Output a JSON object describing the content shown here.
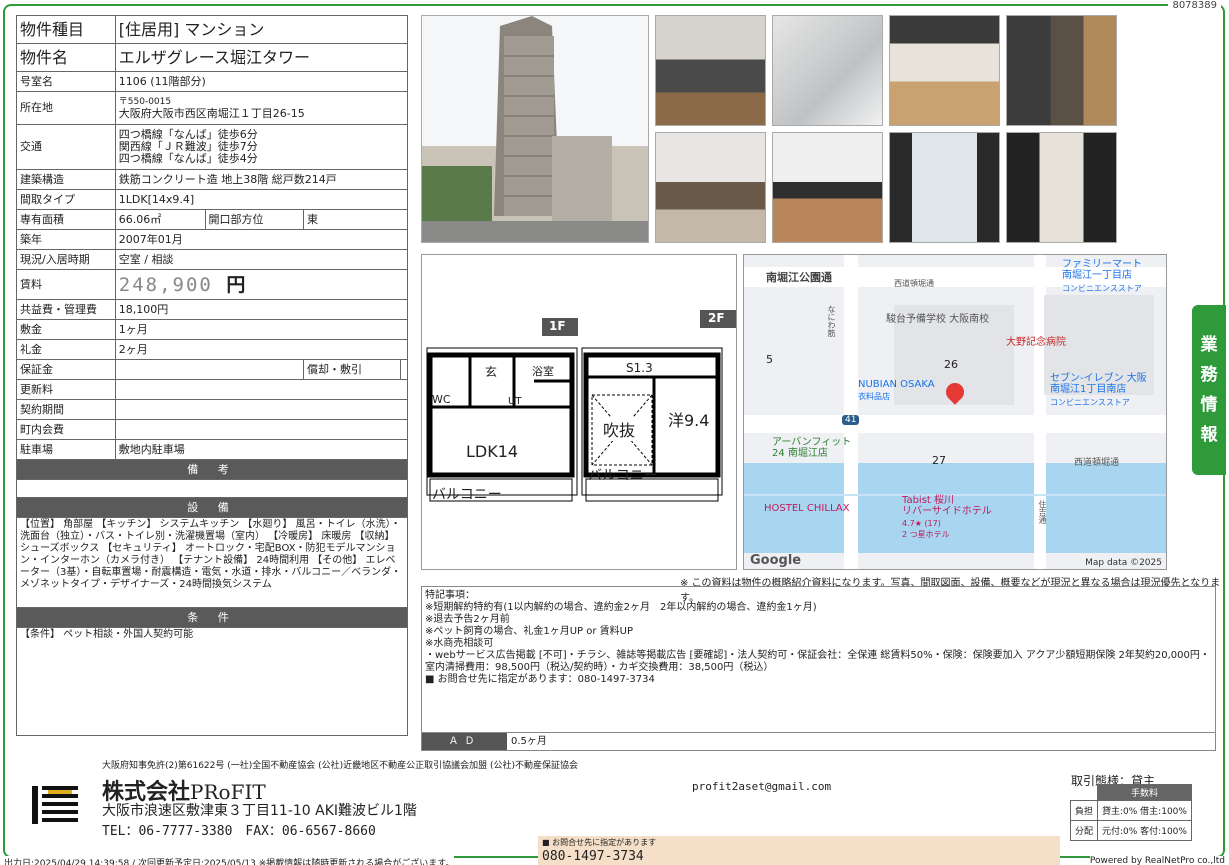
{
  "doc_no": "8078389",
  "spec": {
    "type_label": "物件種目",
    "type_value": "[住居用] マンション",
    "name_label": "物件名",
    "name_value": "エルザグレース堀江タワー",
    "room_label": "号室名",
    "room_value": "1106 (11階部分)",
    "addr_label": "所在地",
    "zip": "〒550-0015",
    "addr": "大阪府大阪市西区南堀江１丁目26-15",
    "traffic_label": "交通",
    "traffic": [
      "四つ橋線「なんば」徒歩6分",
      "関西線「ＪＲ難波」徒歩7分",
      "四つ橋線「なんば」徒歩4分"
    ],
    "structure_label": "建築構造",
    "structure": "鉄筋コンクリート造 地上38階 総戸数214戸",
    "layout_label": "間取タイプ",
    "layout": "1LDK[14x9.4]",
    "area_label": "専有面積",
    "area": "66.06㎡",
    "dir_label": "開口部方位",
    "dir": "東",
    "built_label": "築年",
    "built": "2007年01月",
    "status_label": "現況/入居時期",
    "status": "空室 / 相談",
    "rent_label": "賃料",
    "rent": "248,900",
    "yen": "円",
    "fee_label": "共益費・管理費",
    "fee": "18,100円",
    "deposit_label": "敷金",
    "deposit": "1ヶ月",
    "key_label": "礼金",
    "key": "2ヶ月",
    "hosho_label": "保証金",
    "shokyaku": "償却・敷引",
    "renew_label": "更新料",
    "period_label": "契約期間",
    "town_label": "町内会費",
    "parking_label": "駐車場",
    "parking": "敷地内駐車場",
    "remarks_title": "備 考",
    "equip_title": "設 備",
    "equip": "【位置】 角部屋 【キッチン】 システムキッチン 【水廻り】 風呂・トイレ（水洗）・洗面台（独立）・バス・トイレ別・洗濯機置場（室内） 【冷暖房】 床暖房 【収納】 シューズボックス 【セキュリティ】 オートロック・宅配BOX・防犯モデルマンション・インターホン（カメラ付き） 【テナント設備】 24時間利用 【その他】 エレベーター（3基）・自転車置場・耐震構造・電気・水道・排水・バルコニー／ベランダ・メゾネットタイプ・デザイナーズ・24時間換気システム",
    "cond_title": "条 件",
    "cond": "【条件】 ペット相談・外国人契約可能"
  },
  "floorplan": {
    "f1": "1F",
    "f2": "2F",
    "genkan": "玄",
    "yokushitsu": "浴室",
    "wc": "WC",
    "ut": "UT",
    "ldk": "LDK14",
    "balcony1": "バルコニー",
    "s13": "S1.3",
    "fukinuke": "吹抜",
    "yo": "洋9.4",
    "balcony2": "バルコニー"
  },
  "map": {
    "road1": "南堀江公園通",
    "road2": "西道頓堀通",
    "road3": "西道頓堀通",
    "school": "駿台予備学校 大阪南校",
    "hospital": "大野記念病院",
    "fm": "ファミリーマート\n南堀江一丁目店",
    "fm_sub": "コンビニエンスストア",
    "se": "セブン-イレブン 大阪\n南堀江1丁目南店",
    "se_sub": "コンビニエンスストア",
    "nubian": "NUBIAN OSAKA",
    "nubian_sub": "衣料品店",
    "gym": "アーバンフィット\n24 南堀江店",
    "hostel": "HOSTEL CHILLAX",
    "tabist": "Tabist 桜川\nリバーサイドホテル",
    "rating": "4.7★ (17)",
    "hotel2": "2 つ星ホテル",
    "block5": "5",
    "block26": "26",
    "block27": "27",
    "route41": "41",
    "google": "Google",
    "mapdata": "Map data ©2025",
    "vert1": "なにわ筋",
    "vert2": "住吉通"
  },
  "map_note": "※ この資料は物件の概略紹介資料になります。写真、間取図面、設備、概要などが現況と異なる場合は現況優先となります。",
  "notes": "特記事項：\n※短期解約特約有(1以内解約の場合、違約金2ヶ月　2年以内解約の場合、違約金1ヶ月)\n※退去予告2ヶ月前\n※ペット飼育の場合、礼金1ヶ月UP or 賃料UP\n※水商売相談可\n・webサービス広告掲載 [不可]・チラシ、雑誌等掲載広告 [要確認]・法人契約可・保証会社：全保連 総賃料50%・保険：保険要加入 アクア少額短期保険 2年契約20,000円・室内清掃費用：98,500円（税込/契約時）・カギ交換費用：38,500円（税込）\n■ お問合せ先に指定があります：080-1497-3734",
  "ad_label": "ＡＤ",
  "ad_value": "0.5ヶ月",
  "tab": [
    "業",
    "務",
    "情",
    "報"
  ],
  "footer": {
    "license": "大阪府知事免許(2)第61622号 (一社)全国不動産協会 (公社)近畿地区不動産公正取引協議会加盟 (公社)不動産保証協会",
    "company": "株式会社",
    "company_en": "PRoFIT",
    "address": "大阪市浪速区敷津東３丁目11-10 AKI難波ビル1階",
    "tel": "TEL：06-7777-3380　FAX：06-6567-8660",
    "email": "profit2aset@gmail.com",
    "contact_note": "■ お問合せ先に指定があります",
    "contact_tel": "080-1497-3734",
    "deal_label": "取引態様：貸主",
    "fee_title": "手数料",
    "futan_label": "負担",
    "futan": "貸主:0% 借主:100%",
    "bunpai_label": "分配",
    "bunpai": "元付:0% 客付:100%",
    "output": "出力日:2025/04/29 14:39:58 / 次回更新予定日:2025/05/13 ※掲載情報は随時更新される場合がございます。",
    "powered": "Powered by RealNetPro co.,ltd"
  }
}
